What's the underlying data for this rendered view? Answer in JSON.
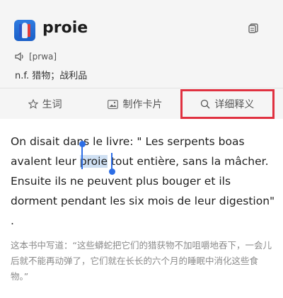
{
  "header": {
    "word": "proie",
    "phonetic": "[prwa]",
    "meaning": "n.f. 猎物；战利品"
  },
  "icons": {
    "app": "french-dictionary-app-icon",
    "copy": "copy-icon",
    "sound": "speaker-icon"
  },
  "actions": [
    {
      "label": "生词",
      "icon": "star-icon"
    },
    {
      "label": "制作卡片",
      "icon": "image-card-icon"
    },
    {
      "label": "详细释义",
      "icon": "search-icon"
    }
  ],
  "passage": {
    "before": "On disait dans le livre: \" Les serpents boas avalent leur ",
    "selected": "proie",
    "after": " tout entière, sans la mâcher. Ensuite ils ne peuvent plus bouger et ils dorment pendant les six mois de leur digestion\" ."
  },
  "translation": "这本书中写道：“这些蟒蛇把它们的猎获物不加咀嚼地吞下，一会儿后就不能再动弹了，它们就在长长的六个月的睡眠中消化这些食物。”",
  "colors": {
    "highlight_border": "#e03140",
    "selection": "#cfe0f3",
    "handle": "#2d6ee6"
  }
}
